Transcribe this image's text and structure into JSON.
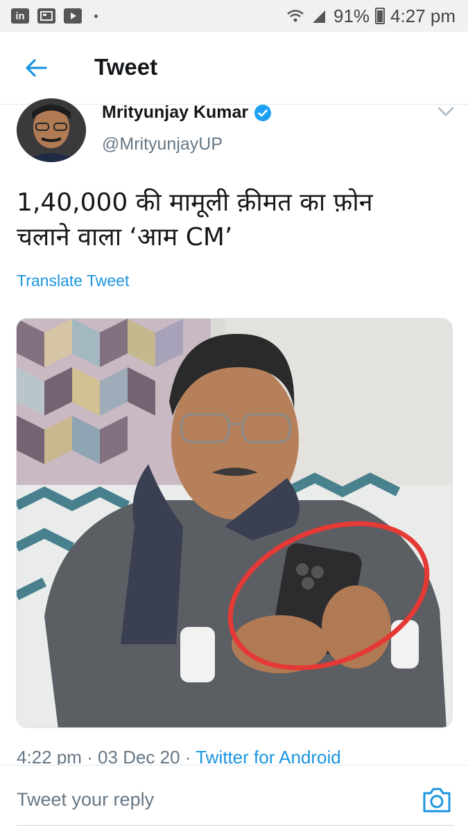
{
  "status_bar": {
    "apps": [
      "in",
      "news",
      "youtube"
    ],
    "battery": "91%",
    "time": "4:27 pm"
  },
  "header": {
    "title": "Tweet",
    "back_icon": "arrow-left-icon"
  },
  "tweet": {
    "author_name": "Mrityunjay Kumar",
    "verified": true,
    "handle": "@MrityunjayUP",
    "text_line1": "1,40,000 की मामूली क़ीमत का फ़ोन",
    "text_line2": "चलाने वाला ‘आम CM’",
    "translate_label": "Translate Tweet",
    "timestamp": "4:22 pm · 03 Dec 20 · ",
    "source": "Twitter for Android"
  },
  "reply": {
    "placeholder": "Tweet your reply",
    "camera_icon": "camera-icon"
  },
  "colors": {
    "accent": "#1b95e0",
    "secondary_text": "#657786",
    "highlight_circle": "#e53935"
  }
}
